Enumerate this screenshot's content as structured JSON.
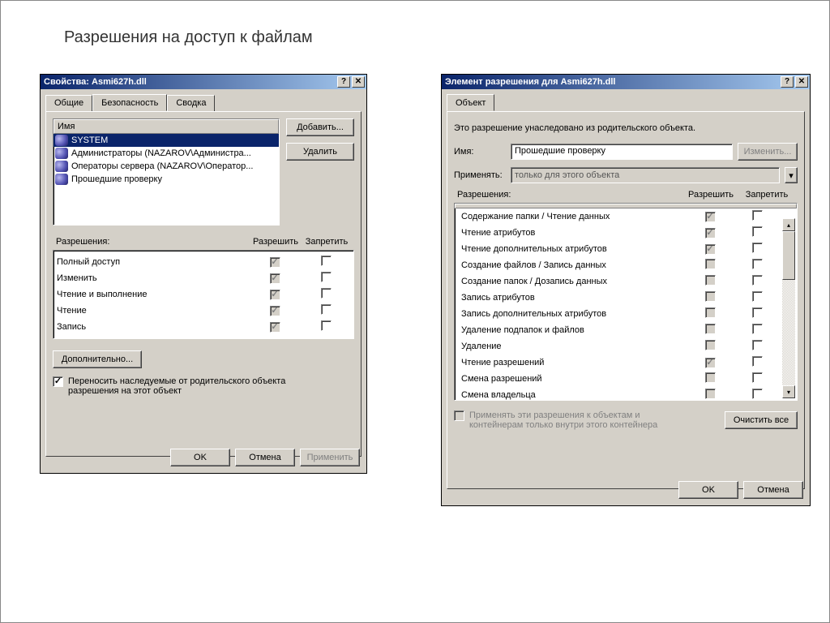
{
  "page_title": "Разрешения на доступ к  файлам",
  "left_dialog": {
    "title": "Свойства: Asmi627h.dll",
    "tabs": {
      "general": "Общие",
      "security": "Безопасность",
      "summary": "Сводка"
    },
    "name_header": "Имя",
    "principals": [
      {
        "label": "SYSTEM",
        "selected": true
      },
      {
        "label": "Администраторы (NAZAROV\\Администра...",
        "selected": false
      },
      {
        "label": "Операторы сервера (NAZAROV\\Оператор...",
        "selected": false
      },
      {
        "label": "Прошедшие проверку",
        "selected": false
      }
    ],
    "add_btn": "Добавить...",
    "remove_btn": "Удалить",
    "perm_label": "Разрешения:",
    "allow": "Разрешить",
    "deny": "Запретить",
    "perms": [
      {
        "label": "Полный доступ",
        "allow": true,
        "deny": false
      },
      {
        "label": "Изменить",
        "allow": true,
        "deny": false
      },
      {
        "label": "Чтение и выполнение",
        "allow": true,
        "deny": false
      },
      {
        "label": "Чтение",
        "allow": true,
        "deny": false
      },
      {
        "label": "Запись",
        "allow": true,
        "deny": false
      }
    ],
    "advanced_btn": "Дополнительно...",
    "inherit_chk": "Переносить наследуемые от родительского объекта разрешения на этот объект",
    "ok": "OK",
    "cancel": "Отмена",
    "apply": "Применить"
  },
  "right_dialog": {
    "title": "Элемент разрешения для Asmi627h.dll",
    "tab": "Объект",
    "inherited_text": "Это разрешение унаследовано из родительского объекта.",
    "name_label": "Имя:",
    "name_value": "Прошедшие проверку",
    "change_btn": "Изменить...",
    "apply_label": "Применять:",
    "apply_value": "только для этого объекта",
    "perm_label": "Разрешения:",
    "allow": "Разрешить",
    "deny": "Запретить",
    "perms": [
      {
        "label": "Содержание папки / Чтение данных",
        "allow": true,
        "deny": false
      },
      {
        "label": "Чтение атрибутов",
        "allow": true,
        "deny": false
      },
      {
        "label": "Чтение дополнительных атрибутов",
        "allow": true,
        "deny": false
      },
      {
        "label": "Создание файлов / Запись данных",
        "allow": false,
        "deny": false
      },
      {
        "label": "Создание папок / Дозапись данных",
        "allow": false,
        "deny": false
      },
      {
        "label": "Запись атрибутов",
        "allow": false,
        "deny": false
      },
      {
        "label": "Запись дополнительных атрибутов",
        "allow": false,
        "deny": false
      },
      {
        "label": "Удаление подпапок и файлов",
        "allow": false,
        "deny": false
      },
      {
        "label": "Удаление",
        "allow": false,
        "deny": false
      },
      {
        "label": "Чтение разрешений",
        "allow": true,
        "deny": false
      },
      {
        "label": "Смена разрешений",
        "allow": false,
        "deny": false
      },
      {
        "label": "Смена владельца",
        "allow": false,
        "deny": false
      }
    ],
    "apply_only_chk": "Применять эти разрешения к объектам и контейнерам только внутри этого контейнера",
    "clear_btn": "Очистить все",
    "ok": "OK",
    "cancel": "Отмена"
  }
}
